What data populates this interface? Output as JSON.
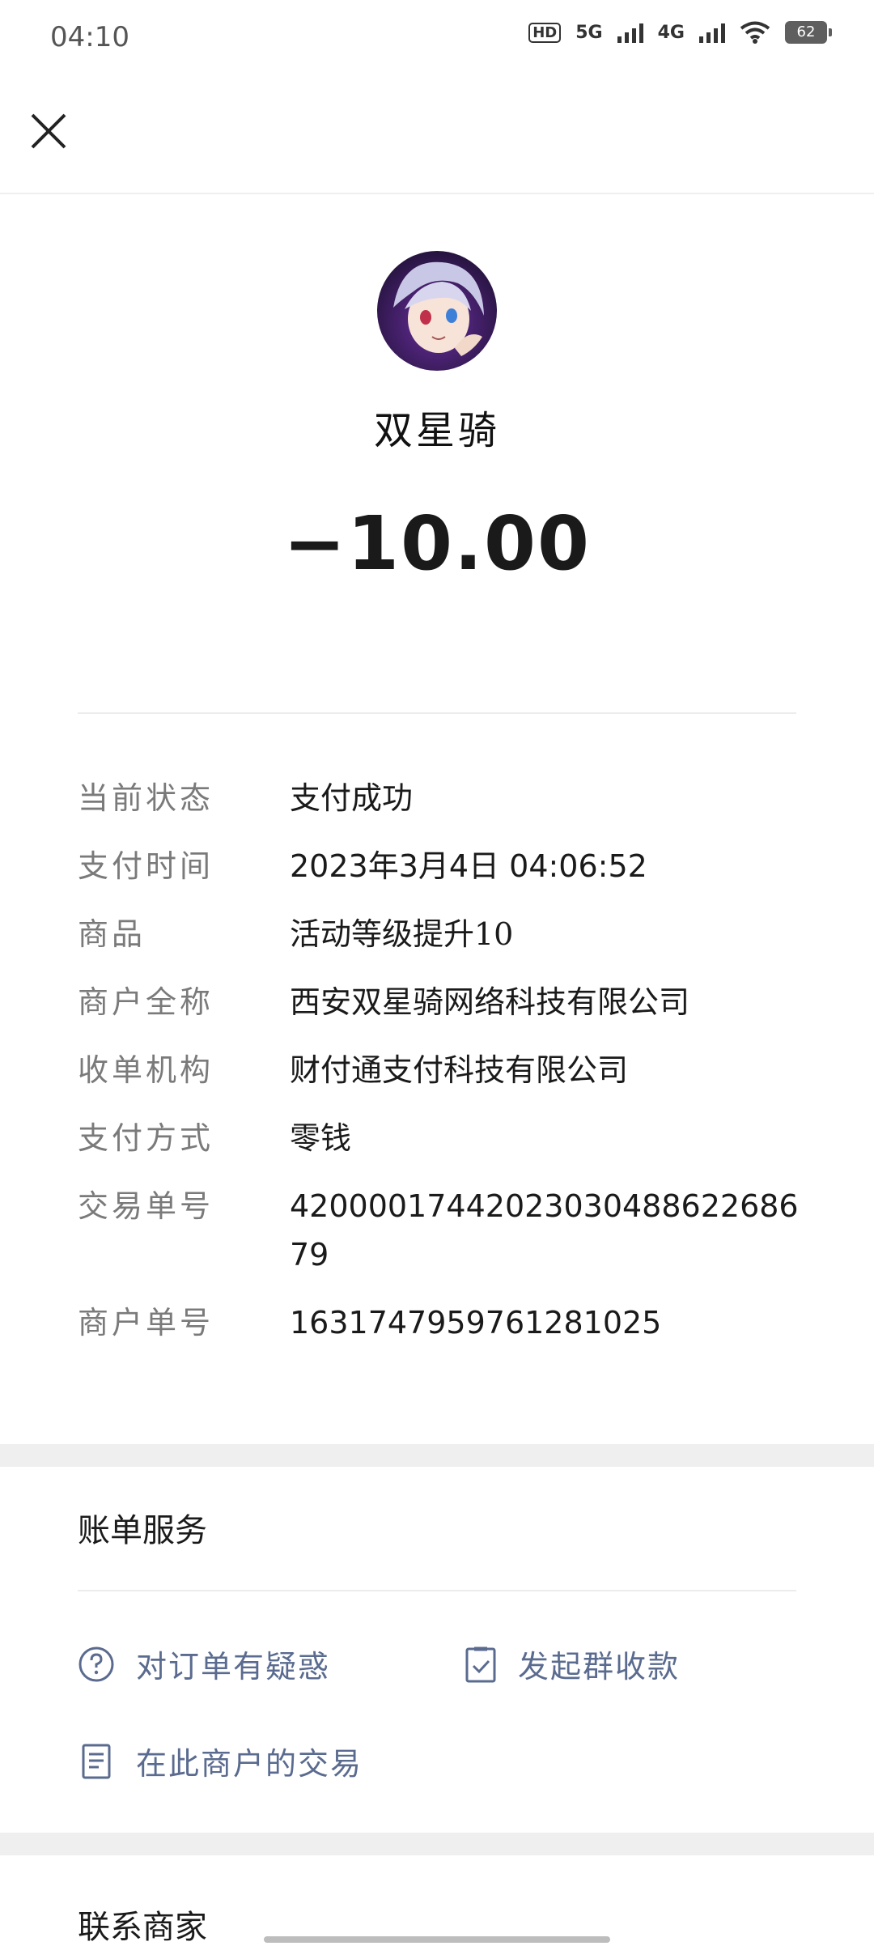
{
  "status_bar": {
    "time": "04:10",
    "hd_label": "HD",
    "net1": "5G",
    "net2": "4G",
    "battery": "62"
  },
  "merchant": {
    "name": "双星骑",
    "amount": "−10.00"
  },
  "details": [
    {
      "label": "当前状态",
      "value": "支付成功"
    },
    {
      "label": "支付时间",
      "value": "2023年3月4日 04:06:52"
    },
    {
      "label": "商品",
      "value": "活动等级提升10"
    },
    {
      "label": "商户全称",
      "value": "西安双星骑网络科技有限公司"
    },
    {
      "label": "收单机构",
      "value": "财付通支付科技有限公司"
    },
    {
      "label": "支付方式",
      "value": "零钱"
    },
    {
      "label": "交易单号",
      "value": "4200001744202303048862268679"
    },
    {
      "label": "商户单号",
      "value": "1631747959761281025"
    }
  ],
  "services": {
    "title": "账单服务",
    "items": [
      {
        "label": "对订单有疑惑",
        "icon": "question-circle-icon"
      },
      {
        "label": "发起群收款",
        "icon": "checklist-icon"
      },
      {
        "label": "在此商户的交易",
        "icon": "document-icon"
      }
    ]
  },
  "contact": {
    "title": "联系商家"
  },
  "colors": {
    "link": "#5a6b8f",
    "label": "#7a7a7a",
    "gap": "#efefef"
  }
}
